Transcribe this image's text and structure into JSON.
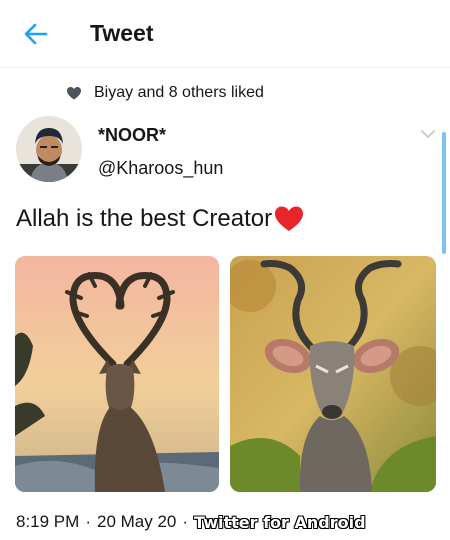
{
  "header": {
    "title": "Tweet",
    "back_icon": "arrow-left-icon",
    "accent": "#1da1f2"
  },
  "social_context": {
    "icon": "heart-icon",
    "text": "Biyay and 8 others liked"
  },
  "author": {
    "name": "*NOOR*",
    "handle": "@Kharoos_hun",
    "avatar": "avatar-photo"
  },
  "tweet": {
    "text": "Allah is the best Creator",
    "emoji": "red-heart",
    "emoji_color": "#e8252b"
  },
  "media": [
    {
      "name": "deer-heart-antlers-photo"
    },
    {
      "name": "kudu-antelope-photo"
    }
  ],
  "meta": {
    "time": "8:19 PM",
    "date": "20 May 20",
    "separator": "·",
    "client": "Twitter for Android"
  }
}
